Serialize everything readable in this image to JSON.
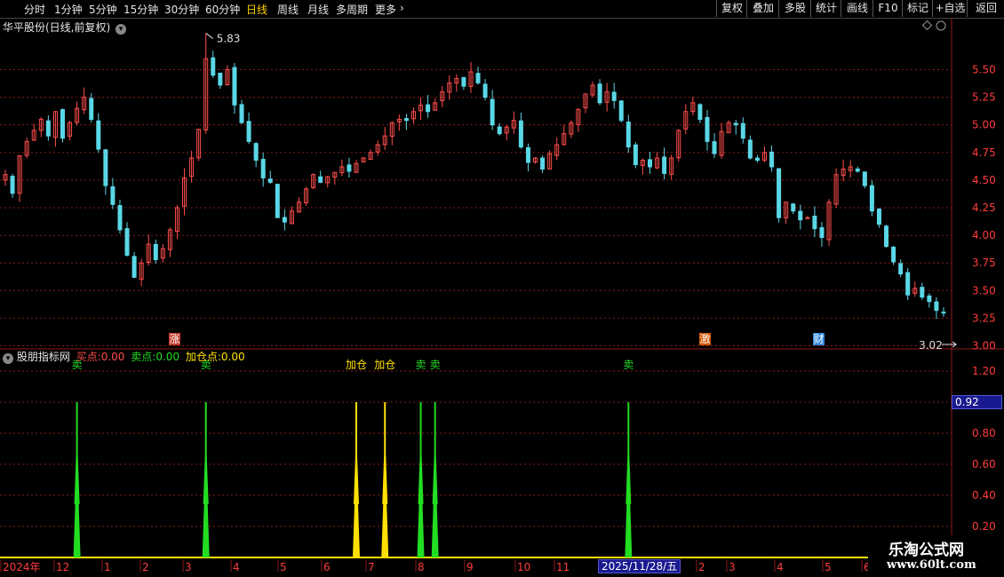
{
  "toolbar": {
    "periods": [
      {
        "label": "分时",
        "active": false
      },
      {
        "label": "1分钟",
        "active": false
      },
      {
        "label": "5分钟",
        "active": false
      },
      {
        "label": "15分钟",
        "active": false
      },
      {
        "label": "30分钟",
        "active": false
      },
      {
        "label": "60分钟",
        "active": false
      },
      {
        "label": "日线",
        "active": true
      },
      {
        "label": "周线",
        "active": false
      },
      {
        "label": "月线",
        "active": false
      },
      {
        "label": "多周期",
        "active": false
      },
      {
        "label": "更多",
        "active": false
      }
    ],
    "buttons": [
      "复权",
      "叠加",
      "多股",
      "统计",
      "画线",
      "F10",
      "标记",
      "+自选",
      "返回"
    ]
  },
  "price_panel": {
    "title": "华平股份(日线,前复权)",
    "high_label": "5.83",
    "low_label": "3.02",
    "markers": [
      {
        "text": "涨",
        "color": "#c0392b"
      },
      {
        "text": "激",
        "color": "#d35400"
      },
      {
        "text": "财",
        "color": "#2e86de"
      }
    ]
  },
  "indicator_panel": {
    "name": "股朋指标网",
    "buy_label": "买点:",
    "buy_value": "0.00",
    "sell_label": "卖点:",
    "sell_value": "0.00",
    "add_label": "加仓点:",
    "add_value": "0.00",
    "current_value": "0.92",
    "signal_labels": {
      "sell": "卖",
      "add": "加仓"
    }
  },
  "time_axis": {
    "labels": [
      "2024年",
      "12",
      "1",
      "2",
      "3",
      "4",
      "5",
      "6",
      "7",
      "8",
      "9",
      "10",
      "11",
      "2",
      "3",
      "4",
      "5",
      "6"
    ],
    "cursor_date": "2025/11/28/五"
  },
  "watermark": {
    "line1": "乐淘公式网",
    "line2": "www.60lt.com"
  },
  "colors": {
    "up": "#ff4d4d",
    "down": "#5ad7e6",
    "sell": "#22dd22",
    "add": "#ffe000",
    "grid": "#8b1a1a",
    "axis_text": "#ff3b3b"
  },
  "chart_data": [
    {
      "type": "candlestick",
      "title": "",
      "y_axis_ticks": [
        5.5,
        5.25,
        5.0,
        4.75,
        4.5,
        4.25,
        4.0,
        3.75,
        3.5,
        3.25,
        3.0
      ],
      "ylim": [
        2.98,
        5.97
      ],
      "closes": [
        4.55,
        4.38,
        4.72,
        4.85,
        4.95,
        5.05,
        4.9,
        5.12,
        4.88,
        5.02,
        5.15,
        5.25,
        5.05,
        4.78,
        4.45,
        4.28,
        4.05,
        3.82,
        3.62,
        3.75,
        3.92,
        3.78,
        3.88,
        4.05,
        4.25,
        4.52,
        4.7,
        4.96,
        5.6,
        5.45,
        5.36,
        5.5,
        5.18,
        5.02,
        4.85,
        4.68,
        4.52,
        4.48,
        4.16,
        4.12,
        4.22,
        4.3,
        4.42,
        4.55,
        4.48,
        4.53,
        4.57,
        4.62,
        4.58,
        4.65,
        4.7,
        4.75,
        4.82,
        4.9,
        5.02,
        5.05,
        5.04,
        5.12,
        5.18,
        5.12,
        5.2,
        5.3,
        5.38,
        5.42,
        5.35,
        5.48,
        5.38,
        5.25,
        5.0,
        4.92,
        4.98,
        5.04,
        4.8,
        4.66,
        4.7,
        4.6,
        4.74,
        4.82,
        4.92,
        5.02,
        5.14,
        5.28,
        5.36,
        5.2,
        5.3,
        5.22,
        5.04,
        4.8,
        4.64,
        4.68,
        4.62,
        4.7,
        4.56,
        4.7,
        4.95,
        5.12,
        5.2,
        5.05,
        4.85,
        4.74,
        4.94,
        5.02,
        5.0,
        4.88,
        4.7,
        4.68,
        4.75,
        4.62,
        4.16,
        4.3,
        4.22,
        4.14,
        4.16,
        4.06,
        3.98,
        4.3,
        4.55,
        4.6,
        4.62,
        4.58,
        4.45,
        4.22,
        4.1,
        3.9,
        3.76,
        3.65,
        3.46,
        3.52,
        3.44,
        3.4,
        3.32,
        3.3
      ],
      "high_point": {
        "index": 28,
        "value": 5.83
      },
      "low_point": {
        "index": 133,
        "value": 3.02
      }
    },
    {
      "type": "bar",
      "title": "股朋指标网",
      "y_axis_ticks": [
        1.2,
        1.0,
        0.8,
        0.6,
        0.4,
        0.2
      ],
      "ylim": [
        0,
        1.32
      ],
      "signals": [
        {
          "kind": "sell",
          "index": 10,
          "value": 1.0
        },
        {
          "kind": "sell",
          "index": 28,
          "value": 1.0
        },
        {
          "kind": "add",
          "index": 49,
          "value": 1.0
        },
        {
          "kind": "add",
          "index": 53,
          "value": 1.0
        },
        {
          "kind": "sell",
          "index": 58,
          "value": 1.0
        },
        {
          "kind": "sell",
          "index": 60,
          "value": 1.0
        },
        {
          "kind": "sell",
          "index": 87,
          "value": 1.0
        }
      ]
    }
  ]
}
